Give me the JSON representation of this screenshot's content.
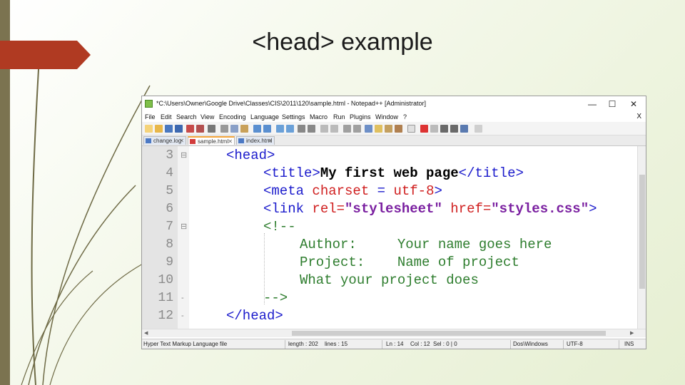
{
  "slide": {
    "title": "<head> example"
  },
  "window": {
    "title": "*C:\\Users\\Owner\\Google Drive\\Classes\\CIS\\2011\\120\\sample.html - Notepad++ [Administrator]",
    "controls": {
      "minimize": "—",
      "maximize": "☐",
      "close": "✕"
    }
  },
  "menu": {
    "items": [
      "File",
      "Edit",
      "Search",
      "View",
      "Encoding",
      "Language",
      "Settings",
      "Macro",
      "Run",
      "Plugins",
      "Window",
      "?"
    ],
    "close": "X"
  },
  "tabs": [
    {
      "label": "change.log",
      "active": false
    },
    {
      "label": "sample.html",
      "active": true
    },
    {
      "label": "index.html",
      "active": false
    }
  ],
  "editor": {
    "line_numbers": [
      "3",
      "4",
      "5",
      "6",
      "7",
      "8",
      "9",
      "10",
      "11",
      "12"
    ],
    "lines": {
      "l3_tag": "<head>",
      "l4_open": "<title>",
      "l4_text": "My first web page",
      "l4_close": "</title>",
      "l5_open": "<meta ",
      "l5_attr": "charset",
      "l5_eq": " = ",
      "l5_val": "utf-8",
      "l5_close": ">",
      "l6_open": "<link ",
      "l6_attr1": "rel=",
      "l6_val1": "\"stylesheet\"",
      "l6_attr2": " href=",
      "l6_val2": "\"styles.css\"",
      "l6_close": ">",
      "l7": "<!--",
      "l8": "Author:     Your name goes here",
      "l9": "Project:    Name of project",
      "l10": "What your project does",
      "l11": "-->",
      "l12": "</head>"
    }
  },
  "status": {
    "filetype": "Hyper Text Markup Language file",
    "length": "length : 202",
    "lines": "lines : 15",
    "ln": "Ln : 14",
    "col": "Col : 12",
    "sel": "Sel : 0 | 0",
    "eol": "Dos\\Windows",
    "encoding": "UTF-8",
    "mode": "INS"
  },
  "colors": {
    "accent_red": "#b03a22",
    "left_bar": "#7b7350",
    "tag_blue": "#1b1bcc",
    "attr_red": "#d02020",
    "string_purple": "#7a1fa0",
    "comment_green": "#2e7d2e"
  }
}
